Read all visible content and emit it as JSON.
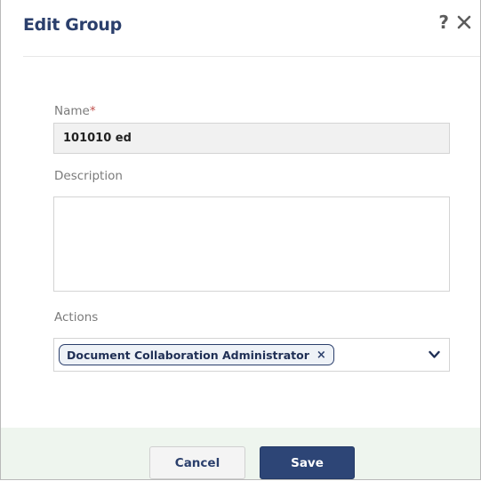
{
  "dialog": {
    "title": "Edit Group",
    "help_icon": "question-mark-icon",
    "close_icon": "close-icon"
  },
  "form": {
    "name": {
      "label": "Name",
      "required_marker": "*",
      "value": "101010 ed"
    },
    "description": {
      "label": "Description",
      "value": ""
    },
    "actions": {
      "label": "Actions",
      "selected_tags": [
        {
          "label": "Document Collaboration Administrator",
          "remove_symbol": "×"
        }
      ]
    }
  },
  "buttons": {
    "cancel_label": "Cancel",
    "save_label": "Save"
  },
  "colors": {
    "title": "#2b3f6c",
    "save_button": "#2d4576",
    "footer_background": "#eef5ee",
    "required_marker": "#c0504d"
  }
}
